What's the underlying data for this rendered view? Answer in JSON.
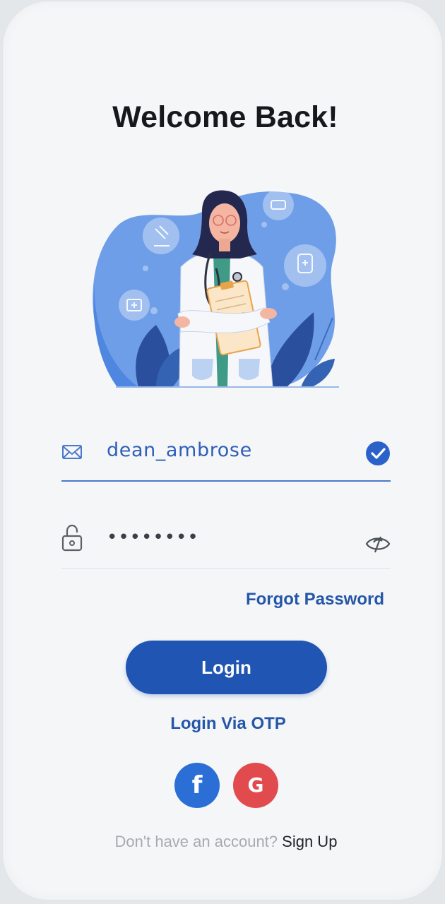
{
  "screen": {
    "title": "Welcome Back!"
  },
  "illustration": {
    "subject": "doctor-with-clipboard-illustration"
  },
  "form": {
    "username": {
      "value": "dean_ambrose",
      "icon": "mail-icon",
      "status_icon": "check-circle-icon",
      "valid": true
    },
    "password": {
      "value": "••••••••",
      "icon": "lock-icon",
      "toggle_icon": "eye-hidden-icon"
    },
    "forgot_label": "Forgot Password",
    "login_label": "Login",
    "otp_label": "Login Via OTP"
  },
  "social": {
    "facebook_glyph": "f",
    "google_glyph": "G"
  },
  "footer": {
    "question": "Don't have an account?",
    "signup_label": "Sign Up"
  },
  "colors": {
    "primary": "#2155b3",
    "accent_blue": "#2f5fb8",
    "facebook": "#2b6fd6",
    "google": "#e24b4e",
    "background": "#f4f6f8"
  }
}
